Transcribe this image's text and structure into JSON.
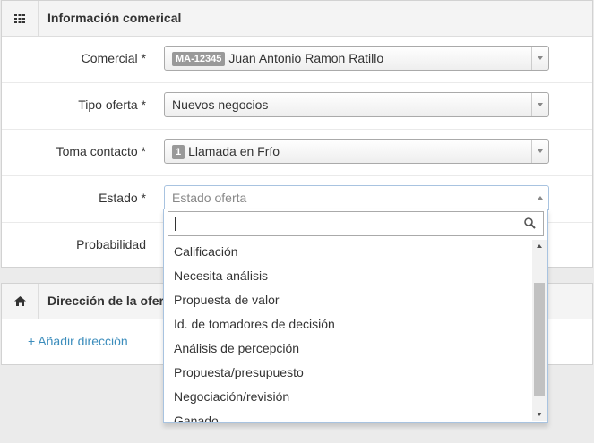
{
  "panel1": {
    "title": "Información comerical",
    "icon": "grid-icon"
  },
  "form": {
    "comercial": {
      "label": "Comercial *",
      "badge": "MA-12345",
      "value": "Juan Antonio Ramon Ratillo"
    },
    "tipo_oferta": {
      "label": "Tipo oferta *",
      "value": "Nuevos negocios"
    },
    "toma_contacto": {
      "label": "Toma contacto *",
      "badge": "1",
      "value": "Llamada en Frío"
    },
    "estado": {
      "label": "Estado *",
      "placeholder": "Estado oferta"
    },
    "probabilidad": {
      "label": "Probabilidad"
    }
  },
  "panel2": {
    "title": "Dirección de la oferta",
    "icon": "home-icon",
    "add_link": "+ Añadir dirección"
  },
  "dropdown": {
    "search_value": "",
    "search_icon": "search-icon",
    "options": [
      "Calificación",
      "Necesita análisis",
      "Propuesta de valor",
      "Id. de tomadores de decisión",
      "Análisis de percepción",
      "Propuesta/presupuesto",
      "Negociación/revisión",
      "Ganado"
    ]
  }
}
